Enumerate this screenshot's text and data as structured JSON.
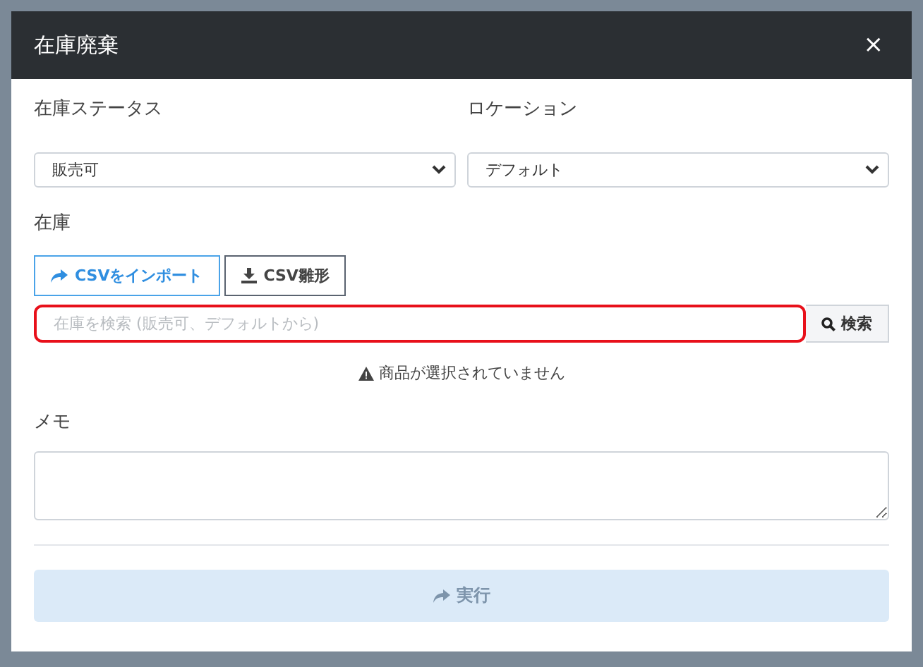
{
  "dialog": {
    "title": "在庫廃棄",
    "close": "×"
  },
  "fields": [
    {
      "label": "在庫ステータス",
      "value": "販売可"
    },
    {
      "label": "ロケーション",
      "value": "デフォルト"
    }
  ],
  "stock": {
    "label": "在庫",
    "buttons": [
      {
        "label": "CSVをインポート",
        "kind": "primary"
      },
      {
        "label": "CSV雛形",
        "kind": "default"
      }
    ],
    "search": {
      "placeholder": "在庫を検索 (販売可、デフォルトから)",
      "highlighted": true,
      "button": "検索"
    },
    "warning": "商品が選択されていません"
  },
  "memo": {
    "label": "メモ"
  },
  "submit": {
    "label": "実行",
    "disabled": true
  }
}
